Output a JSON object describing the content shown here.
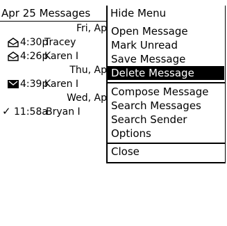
{
  "header": {
    "title": "Apr 25  Messages"
  },
  "messages": [
    {
      "kind": "date",
      "text": "Fri, Ap"
    },
    {
      "kind": "message",
      "icon": "envelope-open-icon",
      "time": "4:30p",
      "sender": "Tracey"
    },
    {
      "kind": "message",
      "icon": "envelope-open-icon",
      "time": "4:26p",
      "sender": "Karen I"
    },
    {
      "kind": "date",
      "text": "Thu, Ap"
    },
    {
      "kind": "message",
      "icon": "envelope-unread-icon",
      "time": "4:39p",
      "sender": "Karen I"
    },
    {
      "kind": "date",
      "text": "Wed, Ap"
    },
    {
      "kind": "message",
      "icon": "checkmark-sent-icon",
      "time": "11:58a",
      "sender": "Bryan I"
    }
  ],
  "menu": {
    "title": "Hide Menu",
    "groups": [
      [
        "Open Message",
        "Mark Unread",
        "Save Message",
        "Delete Message"
      ],
      [
        "Compose Message",
        "Search Messages",
        "Search Sender",
        "Options"
      ],
      [
        "Close"
      ]
    ],
    "selected": "Delete Message"
  }
}
